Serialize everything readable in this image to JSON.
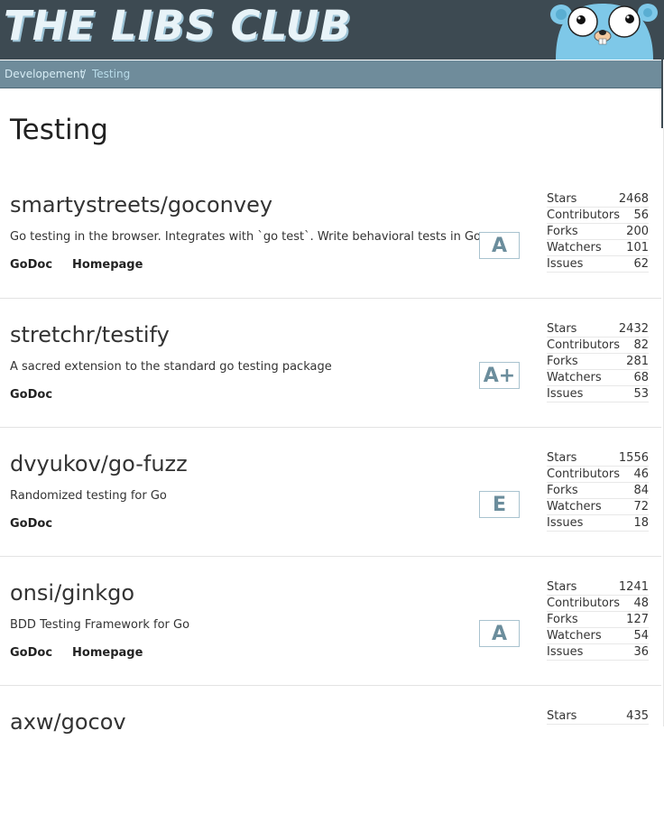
{
  "site": {
    "title": "THE LIBS CLUB"
  },
  "breadcrumb": {
    "items": [
      "Developement"
    ],
    "separator": "/",
    "current": "Testing"
  },
  "page": {
    "title": "Testing"
  },
  "stat_labels": [
    "Stars",
    "Contributors",
    "Forks",
    "Watchers",
    "Issues"
  ],
  "repos": [
    {
      "name": "smartystreets/goconvey",
      "description": "Go testing in the browser. Integrates with `go test`. Write behavioral tests in Go.",
      "links": [
        "GoDoc",
        "Homepage"
      ],
      "grade": "A",
      "stats": [
        "2468",
        "56",
        "200",
        "101",
        "62"
      ]
    },
    {
      "name": "stretchr/testify",
      "description": "A sacred extension to the standard go testing package",
      "links": [
        "GoDoc"
      ],
      "grade": "A+",
      "stats": [
        "2432",
        "82",
        "281",
        "68",
        "53"
      ]
    },
    {
      "name": "dvyukov/go-fuzz",
      "description": "Randomized testing for Go",
      "links": [
        "GoDoc"
      ],
      "grade": "E",
      "stats": [
        "1556",
        "46",
        "84",
        "72",
        "18"
      ]
    },
    {
      "name": "onsi/ginkgo",
      "description": "BDD Testing Framework for Go",
      "links": [
        "GoDoc",
        "Homepage"
      ],
      "grade": "A",
      "stats": [
        "1241",
        "48",
        "127",
        "54",
        "36"
      ]
    },
    {
      "name": "axw/gocov",
      "description": "",
      "links": [],
      "grade": "",
      "stats": [
        "435"
      ]
    }
  ]
}
